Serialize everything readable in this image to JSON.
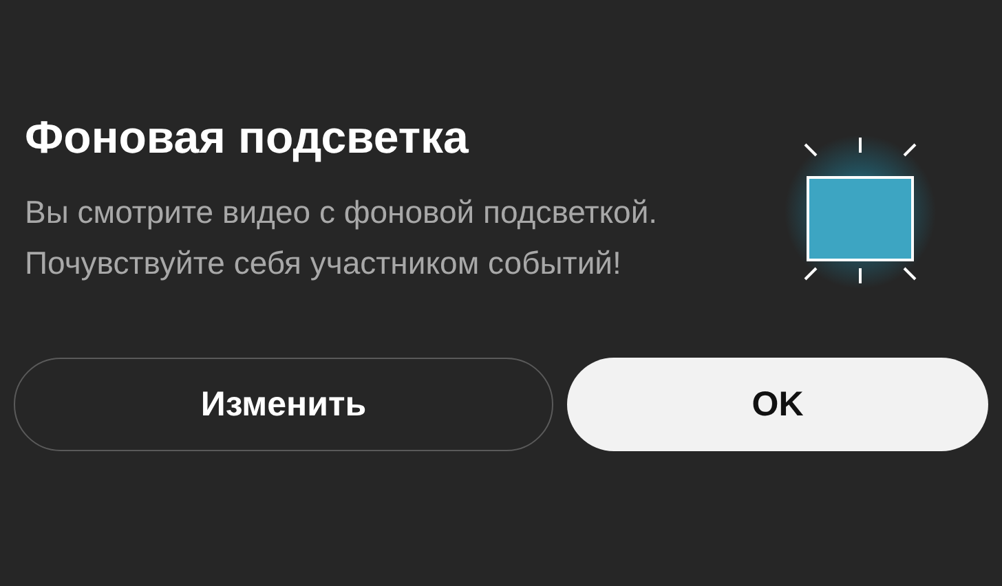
{
  "dialog": {
    "title": "Фоновая подсветка",
    "message": "Вы смотрите видео с фоновой подсветкой. Почувствуйте себя участником событий!"
  },
  "buttons": [
    {
      "label": "Изменить",
      "kind": "outlined"
    },
    {
      "label": "OK",
      "kind": "filled"
    }
  ]
}
